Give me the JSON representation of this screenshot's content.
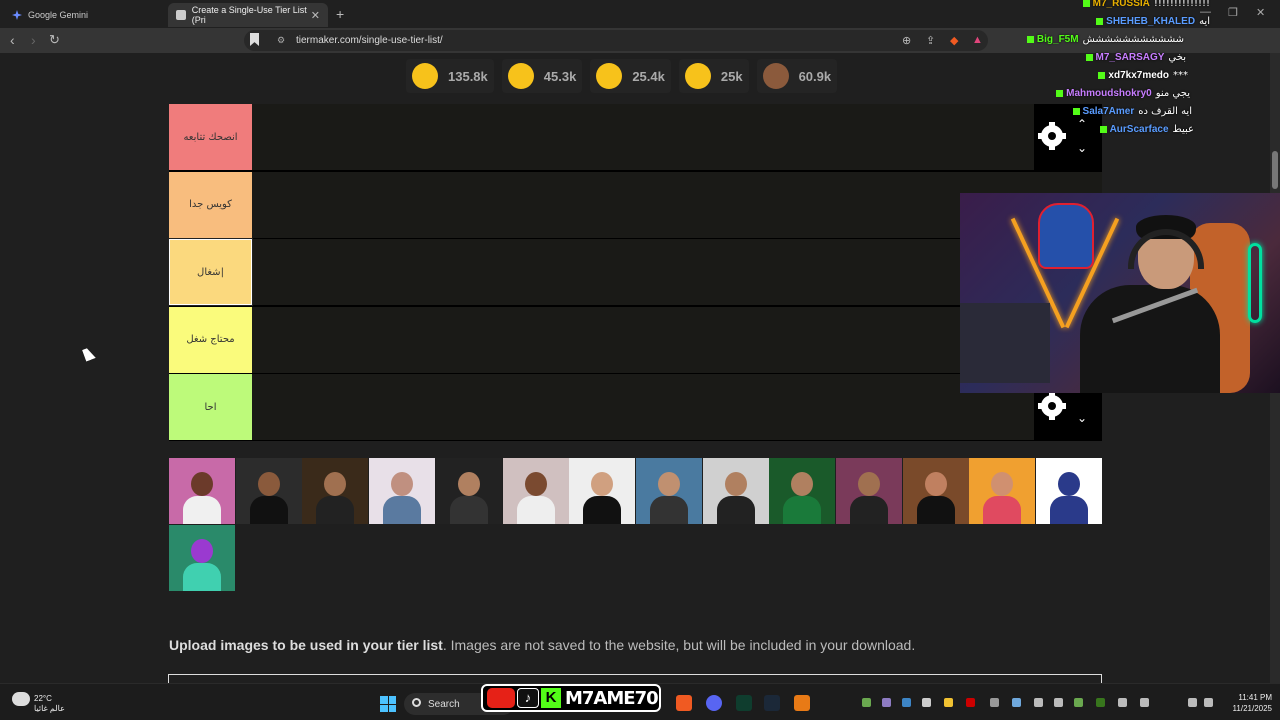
{
  "browser": {
    "tabs": [
      {
        "label": "Google Gemini",
        "active": false
      },
      {
        "label": "Create a Single-Use Tier List (Pri",
        "active": true
      }
    ],
    "url": "tiermaker.com/single-use-tier-list/"
  },
  "reactions": [
    {
      "icon": "grinning-face-icon",
      "count": "135.8k",
      "color": "#f7c21b"
    },
    {
      "icon": "heart-eyes-icon",
      "count": "45.3k",
      "color": "#f7c21b"
    },
    {
      "icon": "tears-of-joy-icon",
      "count": "25.4k",
      "color": "#f7c21b"
    },
    {
      "icon": "raised-hands-icon",
      "count": "25k",
      "color": "#f7c21b"
    },
    {
      "icon": "poop-icon",
      "count": "60.9k",
      "color": "#8b5a3c"
    }
  ],
  "tiers": [
    {
      "label": "انصحك تتابعه",
      "color": "#f07c7c"
    },
    {
      "label": "كويس جدا",
      "color": "#f8bd7e"
    },
    {
      "label": "شغال|",
      "color": "#fbd97e"
    },
    {
      "label": "محتاج شغل",
      "color": "#fafb7c"
    },
    {
      "label": "احا",
      "color": "#bdfa7a"
    }
  ],
  "pool_item_count": 15,
  "upload": {
    "bold": "Upload images to be used in your tier list",
    "rest": ". Images are not saved to the website, but will be included in your download."
  },
  "chat": [
    {
      "name": "M7_RUSSIA",
      "msg": "!!!!!!!!!!!!!!",
      "color": "#e8b000"
    },
    {
      "name": "SHEHEB_KHALED",
      "msg": "ايه",
      "color": "#5a9cff"
    },
    {
      "name": "Big_F5M",
      "msg": "ششششششششششش",
      "color": "#53fc18"
    },
    {
      "name": "M7_SARSAGY",
      "msg": "بخي",
      "color": "#c77dff"
    },
    {
      "name": "xd7kx7medo",
      "msg": "***",
      "color": "#ffffff"
    },
    {
      "name": "Mahmoudshokry0",
      "msg": "يجي منو",
      "color": "#c77dff"
    },
    {
      "name": "Sala7Amer",
      "msg": "ايه القرف ده",
      "color": "#5a9cff"
    },
    {
      "name": "AurScarface",
      "msg": "عبيط",
      "color": "#5a9cff"
    }
  ],
  "taskbar": {
    "temperature": "22°C",
    "weather_desc": "عالم غائيا",
    "search_label": "Search",
    "brand_handle": "M7AME70",
    "time": "11:41 PM",
    "date": "11/21/2025"
  }
}
